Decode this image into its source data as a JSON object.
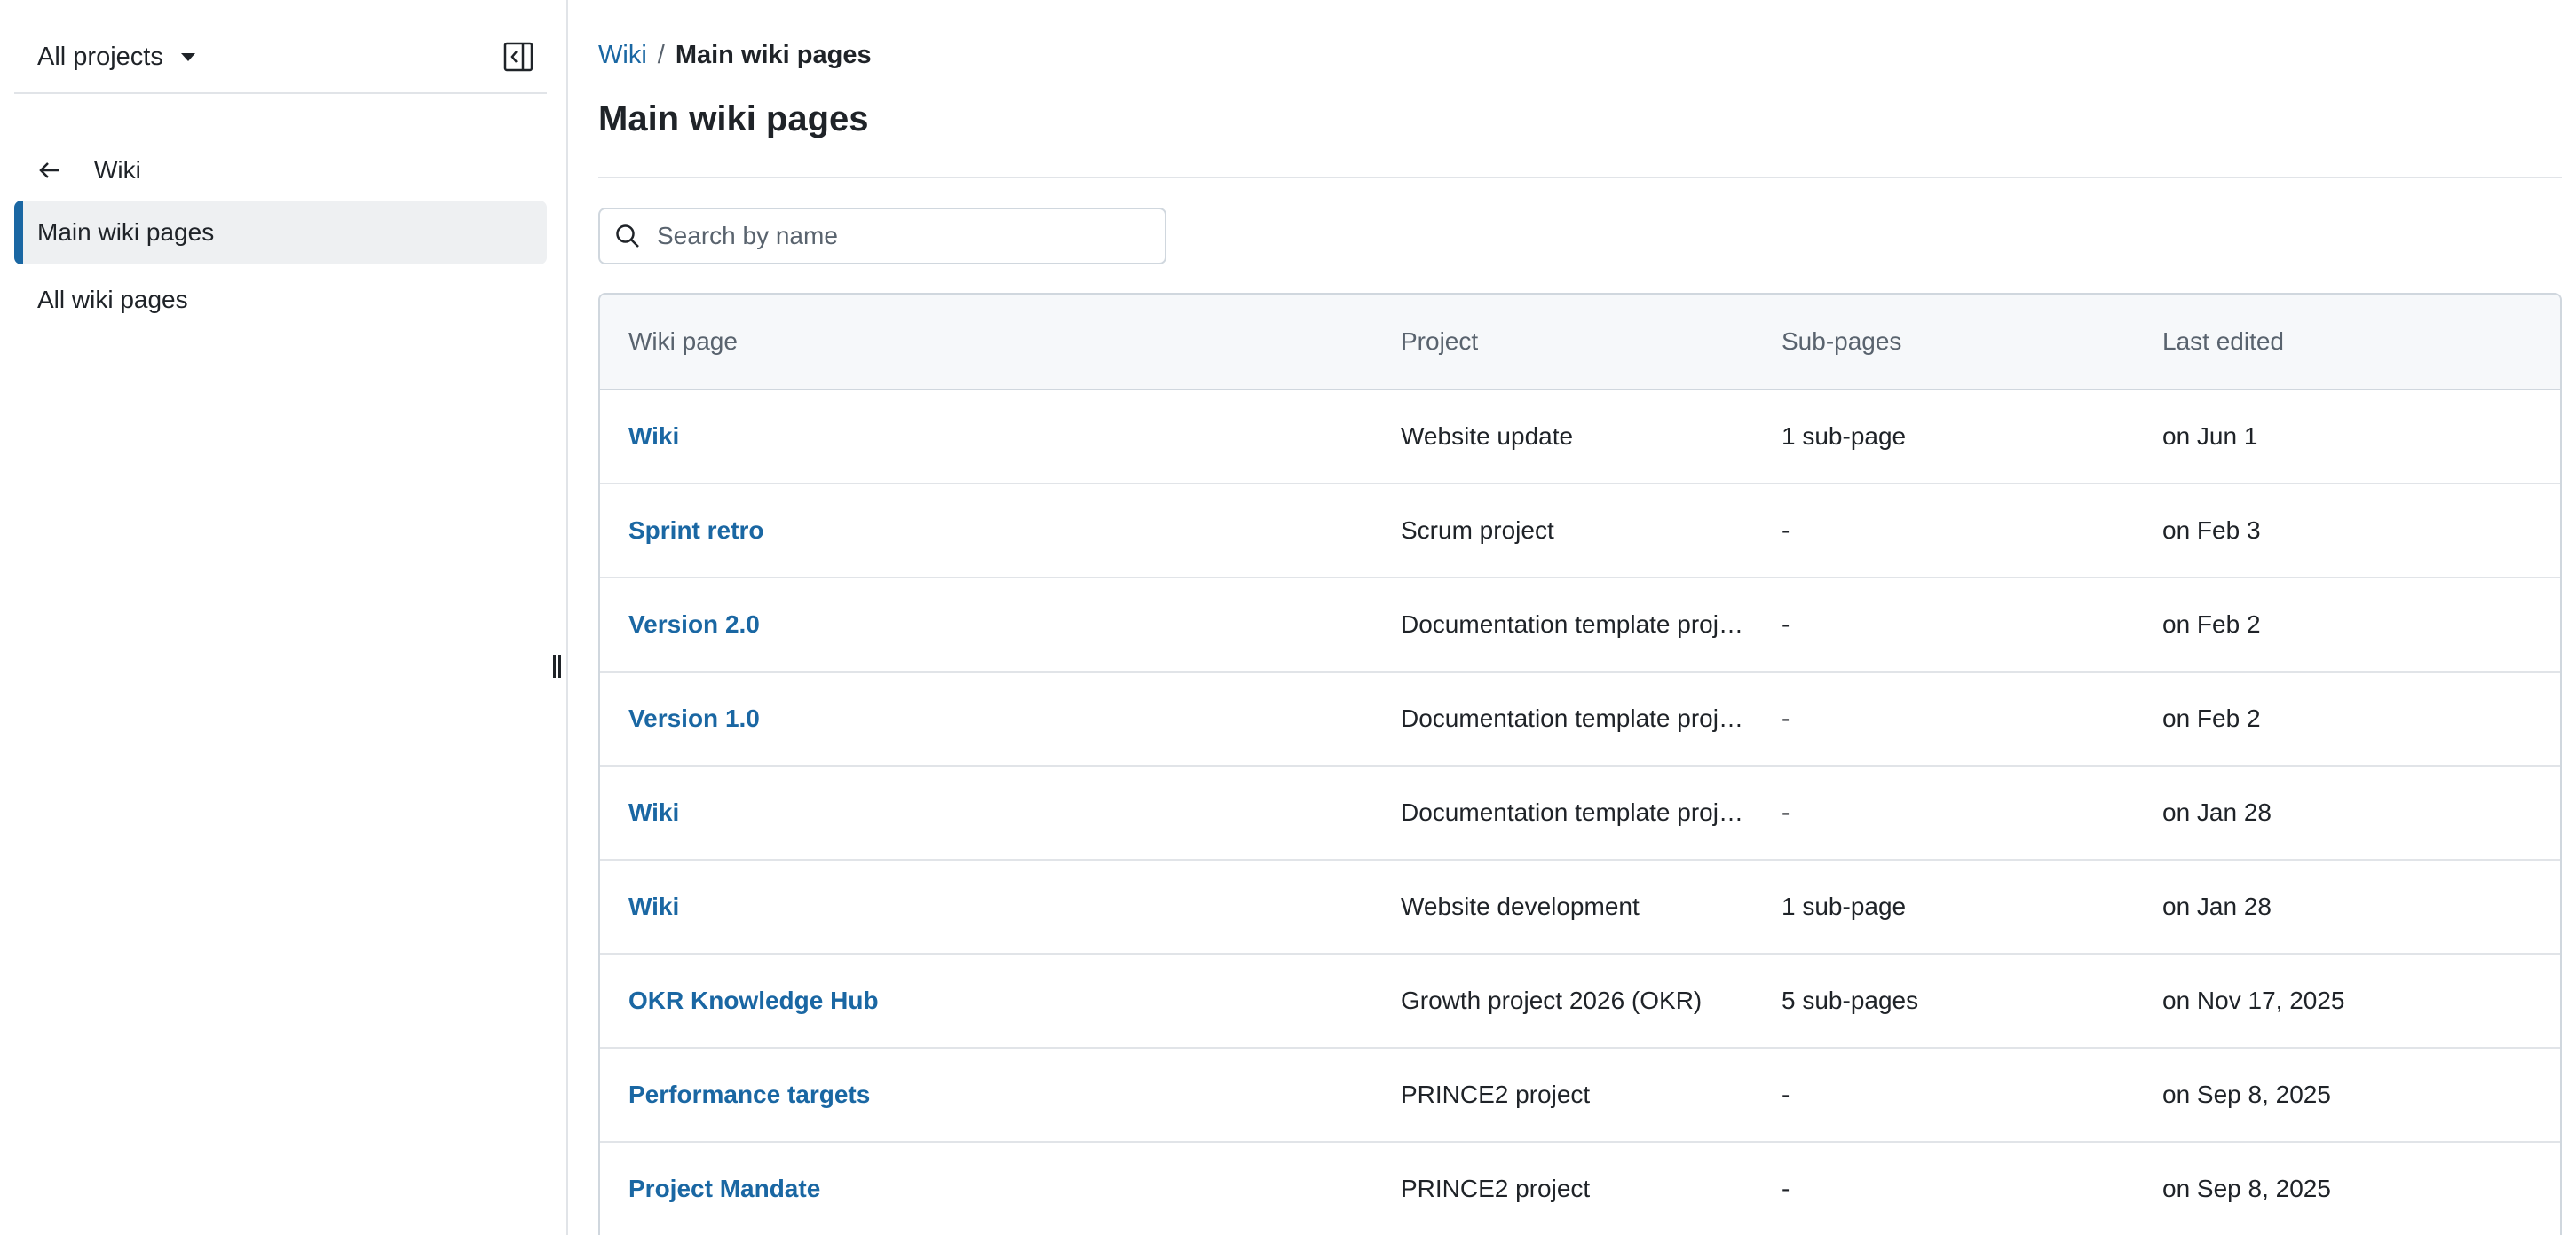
{
  "sidebar": {
    "project_selector": "All projects",
    "back_label": "Wiki",
    "nav": [
      {
        "label": "Main wiki pages",
        "active": true
      },
      {
        "label": "All wiki pages",
        "active": false
      }
    ]
  },
  "breadcrumb": {
    "parent": "Wiki",
    "separator": "/",
    "current": "Main wiki pages"
  },
  "page": {
    "title": "Main wiki pages"
  },
  "search": {
    "placeholder": "Search by name",
    "value": ""
  },
  "table": {
    "headers": [
      "Wiki page",
      "Project",
      "Sub-pages",
      "Last edited"
    ],
    "rows": [
      {
        "page": "Wiki",
        "project": "Website update",
        "subpages": "1 sub-page",
        "edited": "on Jun 1"
      },
      {
        "page": "Sprint retro",
        "project": "Scrum project",
        "subpages": "-",
        "edited": "on Feb 3"
      },
      {
        "page": "Version 2.0",
        "project": "Documentation template proj…",
        "subpages": "-",
        "edited": "on Feb 2"
      },
      {
        "page": "Version 1.0",
        "project": "Documentation template proj…",
        "subpages": "-",
        "edited": "on Feb 2"
      },
      {
        "page": "Wiki",
        "project": "Documentation template proj…",
        "subpages": "-",
        "edited": "on Jan 28"
      },
      {
        "page": "Wiki",
        "project": "Website development",
        "subpages": "1 sub-page",
        "edited": "on Jan 28"
      },
      {
        "page": "OKR Knowledge Hub",
        "project": "Growth project 2026 (OKR)",
        "subpages": "5 sub-pages",
        "edited": "on Nov 17, 2025"
      },
      {
        "page": "Performance targets",
        "project": "PRINCE2 project",
        "subpages": "-",
        "edited": "on Sep 8, 2025"
      },
      {
        "page": "Project Mandate",
        "project": "PRINCE2 project",
        "subpages": "-",
        "edited": "on Sep 8, 2025"
      }
    ]
  },
  "colors": {
    "link": "#1a67a3",
    "active_indicator": "#1a67a3",
    "active_bg": "#eef0f2",
    "header_bg": "#f6f8fa"
  }
}
